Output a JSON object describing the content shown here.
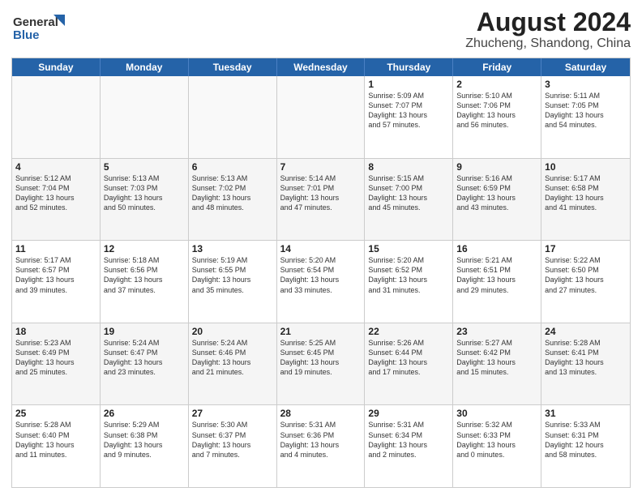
{
  "logo": {
    "line1": "General",
    "line2": "Blue"
  },
  "title": {
    "main": "August 2024",
    "sub": "Zhucheng, Shandong, China"
  },
  "headers": [
    "Sunday",
    "Monday",
    "Tuesday",
    "Wednesday",
    "Thursday",
    "Friday",
    "Saturday"
  ],
  "weeks": [
    [
      {
        "day": "",
        "info": ""
      },
      {
        "day": "",
        "info": ""
      },
      {
        "day": "",
        "info": ""
      },
      {
        "day": "",
        "info": ""
      },
      {
        "day": "1",
        "info": "Sunrise: 5:09 AM\nSunset: 7:07 PM\nDaylight: 13 hours\nand 57 minutes."
      },
      {
        "day": "2",
        "info": "Sunrise: 5:10 AM\nSunset: 7:06 PM\nDaylight: 13 hours\nand 56 minutes."
      },
      {
        "day": "3",
        "info": "Sunrise: 5:11 AM\nSunset: 7:05 PM\nDaylight: 13 hours\nand 54 minutes."
      }
    ],
    [
      {
        "day": "4",
        "info": "Sunrise: 5:12 AM\nSunset: 7:04 PM\nDaylight: 13 hours\nand 52 minutes."
      },
      {
        "day": "5",
        "info": "Sunrise: 5:13 AM\nSunset: 7:03 PM\nDaylight: 13 hours\nand 50 minutes."
      },
      {
        "day": "6",
        "info": "Sunrise: 5:13 AM\nSunset: 7:02 PM\nDaylight: 13 hours\nand 48 minutes."
      },
      {
        "day": "7",
        "info": "Sunrise: 5:14 AM\nSunset: 7:01 PM\nDaylight: 13 hours\nand 47 minutes."
      },
      {
        "day": "8",
        "info": "Sunrise: 5:15 AM\nSunset: 7:00 PM\nDaylight: 13 hours\nand 45 minutes."
      },
      {
        "day": "9",
        "info": "Sunrise: 5:16 AM\nSunset: 6:59 PM\nDaylight: 13 hours\nand 43 minutes."
      },
      {
        "day": "10",
        "info": "Sunrise: 5:17 AM\nSunset: 6:58 PM\nDaylight: 13 hours\nand 41 minutes."
      }
    ],
    [
      {
        "day": "11",
        "info": "Sunrise: 5:17 AM\nSunset: 6:57 PM\nDaylight: 13 hours\nand 39 minutes."
      },
      {
        "day": "12",
        "info": "Sunrise: 5:18 AM\nSunset: 6:56 PM\nDaylight: 13 hours\nand 37 minutes."
      },
      {
        "day": "13",
        "info": "Sunrise: 5:19 AM\nSunset: 6:55 PM\nDaylight: 13 hours\nand 35 minutes."
      },
      {
        "day": "14",
        "info": "Sunrise: 5:20 AM\nSunset: 6:54 PM\nDaylight: 13 hours\nand 33 minutes."
      },
      {
        "day": "15",
        "info": "Sunrise: 5:20 AM\nSunset: 6:52 PM\nDaylight: 13 hours\nand 31 minutes."
      },
      {
        "day": "16",
        "info": "Sunrise: 5:21 AM\nSunset: 6:51 PM\nDaylight: 13 hours\nand 29 minutes."
      },
      {
        "day": "17",
        "info": "Sunrise: 5:22 AM\nSunset: 6:50 PM\nDaylight: 13 hours\nand 27 minutes."
      }
    ],
    [
      {
        "day": "18",
        "info": "Sunrise: 5:23 AM\nSunset: 6:49 PM\nDaylight: 13 hours\nand 25 minutes."
      },
      {
        "day": "19",
        "info": "Sunrise: 5:24 AM\nSunset: 6:47 PM\nDaylight: 13 hours\nand 23 minutes."
      },
      {
        "day": "20",
        "info": "Sunrise: 5:24 AM\nSunset: 6:46 PM\nDaylight: 13 hours\nand 21 minutes."
      },
      {
        "day": "21",
        "info": "Sunrise: 5:25 AM\nSunset: 6:45 PM\nDaylight: 13 hours\nand 19 minutes."
      },
      {
        "day": "22",
        "info": "Sunrise: 5:26 AM\nSunset: 6:44 PM\nDaylight: 13 hours\nand 17 minutes."
      },
      {
        "day": "23",
        "info": "Sunrise: 5:27 AM\nSunset: 6:42 PM\nDaylight: 13 hours\nand 15 minutes."
      },
      {
        "day": "24",
        "info": "Sunrise: 5:28 AM\nSunset: 6:41 PM\nDaylight: 13 hours\nand 13 minutes."
      }
    ],
    [
      {
        "day": "25",
        "info": "Sunrise: 5:28 AM\nSunset: 6:40 PM\nDaylight: 13 hours\nand 11 minutes."
      },
      {
        "day": "26",
        "info": "Sunrise: 5:29 AM\nSunset: 6:38 PM\nDaylight: 13 hours\nand 9 minutes."
      },
      {
        "day": "27",
        "info": "Sunrise: 5:30 AM\nSunset: 6:37 PM\nDaylight: 13 hours\nand 7 minutes."
      },
      {
        "day": "28",
        "info": "Sunrise: 5:31 AM\nSunset: 6:36 PM\nDaylight: 13 hours\nand 4 minutes."
      },
      {
        "day": "29",
        "info": "Sunrise: 5:31 AM\nSunset: 6:34 PM\nDaylight: 13 hours\nand 2 minutes."
      },
      {
        "day": "30",
        "info": "Sunrise: 5:32 AM\nSunset: 6:33 PM\nDaylight: 13 hours\nand 0 minutes."
      },
      {
        "day": "31",
        "info": "Sunrise: 5:33 AM\nSunset: 6:31 PM\nDaylight: 12 hours\nand 58 minutes."
      }
    ]
  ]
}
